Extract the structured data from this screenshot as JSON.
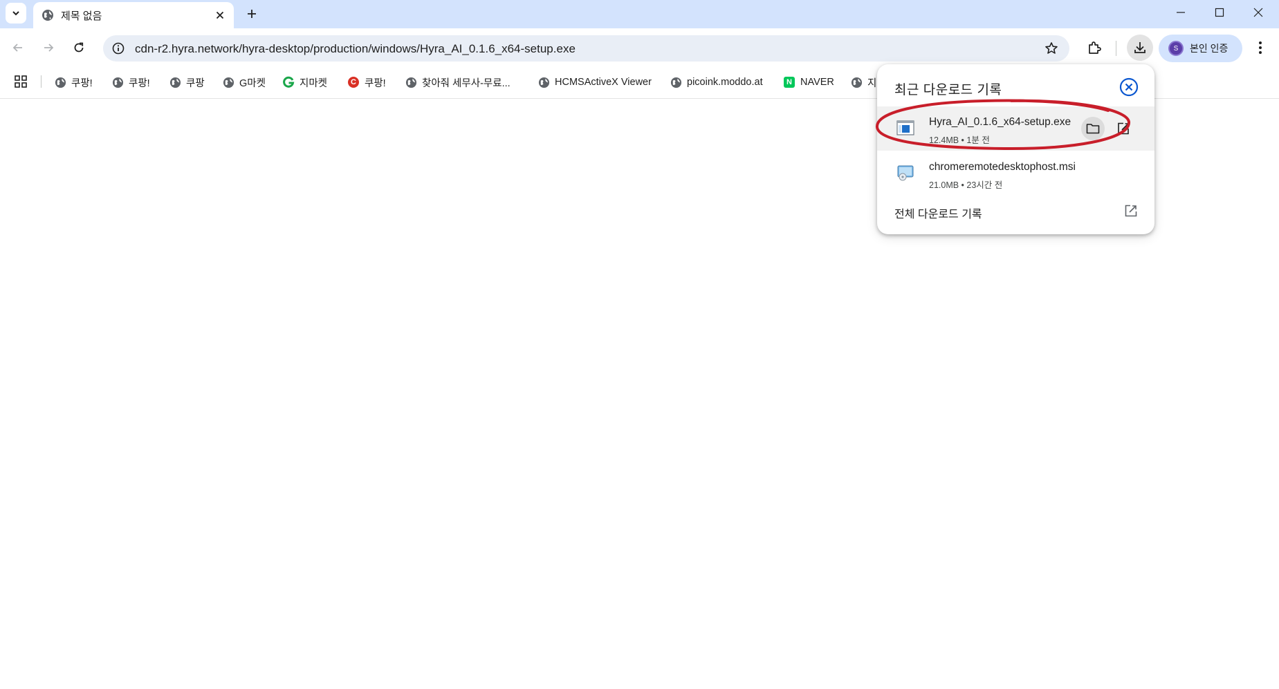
{
  "tab": {
    "title": "제목 없음"
  },
  "omnibox": {
    "url": "cdn-r2.hyra.network/hyra-desktop/production/windows/Hyra_AI_0.1.6_x64-setup.exe"
  },
  "profile": {
    "label": "본인 인증",
    "avatar_letter": "S"
  },
  "bookmarks": [
    {
      "label": "쿠팡!",
      "icon": "globe-icon"
    },
    {
      "label": "쿠팡!",
      "icon": "globe-icon"
    },
    {
      "label": "쿠팡",
      "icon": "globe-icon"
    },
    {
      "label": "G마켓",
      "icon": "globe-icon"
    },
    {
      "label": "지마켓",
      "icon": "gmarket-g-icon"
    },
    {
      "label": "쿠팡!",
      "icon": "red-c-icon"
    },
    {
      "label": "찾아줘 세무사-무료...",
      "icon": "globe-icon"
    },
    {
      "label": "HCMSActiveX Viewer",
      "icon": "globe-icon"
    },
    {
      "label": "picoink.moddo.at",
      "icon": "globe-icon"
    },
    {
      "label": "NAVER",
      "icon": "naver-n-icon"
    },
    {
      "label": "지",
      "icon": "globe-icon"
    }
  ],
  "downloads_panel": {
    "title": "최근 다운로드 기록",
    "items": [
      {
        "name": "Hyra_AI_0.1.6_x64-setup.exe",
        "meta": "12.4MB • 1분 전"
      },
      {
        "name": "chromeremotedesktophost.msi",
        "meta": "21.0MB • 23시간 전"
      }
    ],
    "footer_label": "전체 다운로드 기록"
  },
  "colors": {
    "tabstrip": "#d3e3fd",
    "omnibox": "#e9eef6",
    "accent_blue": "#0b57d0",
    "annotation_red": "#c81e2a"
  }
}
